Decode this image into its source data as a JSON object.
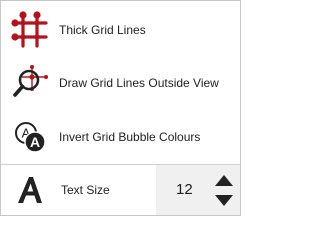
{
  "menu": {
    "items": [
      {
        "label": "Thick Grid Lines",
        "icon": "thick-grid-lines-icon"
      },
      {
        "label": "Draw Grid Lines Outside View",
        "icon": "grid-lines-outside-view-icon"
      },
      {
        "label": "Invert Grid Bubble Colours",
        "icon": "invert-grid-bubble-icon"
      }
    ]
  },
  "text_size": {
    "label": "Text Size",
    "value": "12",
    "icon": "text-size-icon"
  },
  "colors": {
    "accent": "#b5121b",
    "text": "#1f1f1f",
    "stepper_bg": "#f0f0f0"
  }
}
